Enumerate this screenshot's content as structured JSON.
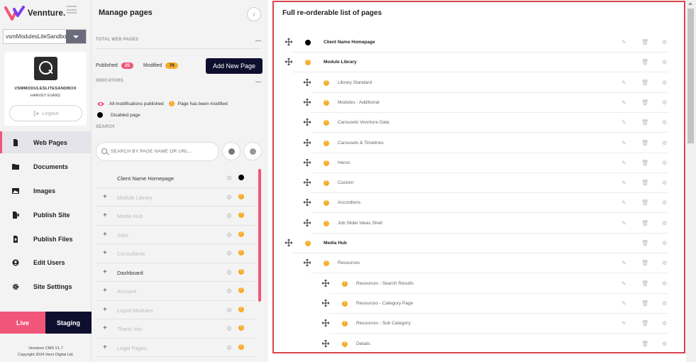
{
  "brand": {
    "name": "Vennture."
  },
  "site_select": {
    "value": "vsmModulesLiteSandbo"
  },
  "profile": {
    "site_name": "VSMMODULESLITESANDBOX",
    "user_name": "HARVEY EVANS",
    "logout_label": "Logout"
  },
  "nav": {
    "items": [
      {
        "label": "Web Pages",
        "icon": "file-icon",
        "active": true
      },
      {
        "label": "Documents",
        "icon": "folder-icon"
      },
      {
        "label": "Images",
        "icon": "image-icon"
      },
      {
        "label": "Publish Site",
        "icon": "publish-icon"
      },
      {
        "label": "Publish Files",
        "icon": "file-upload-icon"
      },
      {
        "label": "Edit Users",
        "icon": "user-icon"
      },
      {
        "label": "Site Settings",
        "icon": "gear-icon"
      }
    ]
  },
  "env": {
    "live_label": "Live",
    "staging_label": "Staging"
  },
  "footer": {
    "version": "Vennture CMS V1.7",
    "copyright": "Copyright 2024 Venn Digital Ltd."
  },
  "manage": {
    "title": "Manage pages",
    "total_label": "TOTAL WEB PAGES",
    "published_label": "Published",
    "published_count": "25",
    "modified_label": "Modified",
    "modified_count": "70",
    "add_button": "Add New Page",
    "indicators_label": "INDICATORS",
    "ind_all_published": "All modifications published",
    "ind_modified": "Page has been modified",
    "ind_disabled": "Disabled page",
    "search_label": "SEARCH",
    "search_placeholder": "SEARCH BY PAGE NAME OR URL...",
    "pages": [
      {
        "label": "Client Name Homepage",
        "status": "black",
        "expand": false,
        "muted": false
      },
      {
        "label": "Module Library",
        "status": "orange",
        "expand": true,
        "muted": true
      },
      {
        "label": "Media Hub",
        "status": "orange",
        "expand": true,
        "muted": true
      },
      {
        "label": "Jobs",
        "status": "orange",
        "expand": true,
        "muted": true
      },
      {
        "label": "Consultants",
        "status": "orange",
        "expand": true,
        "muted": true
      },
      {
        "label": "Dashboard",
        "status": "orange",
        "expand": true,
        "muted": false
      },
      {
        "label": "Account",
        "status": "orange",
        "expand": true,
        "muted": true
      },
      {
        "label": "Liquid Modules",
        "status": "orange",
        "expand": true,
        "muted": true
      },
      {
        "label": "Thank You",
        "status": "orange",
        "expand": true,
        "muted": true
      },
      {
        "label": "Legal Pages",
        "status": "orange",
        "expand": true,
        "muted": true
      }
    ]
  },
  "reorder": {
    "title": "Full re-orderable list of pages",
    "rows": [
      {
        "label": "Client Name Homepage",
        "level": 0,
        "status": "black",
        "bold": true,
        "edit": true
      },
      {
        "label": "Module Library",
        "level": 0,
        "status": "orange",
        "bold": true,
        "edit": false
      },
      {
        "label": "Library Standard",
        "level": 1,
        "status": "orange",
        "bold": false,
        "edit": true
      },
      {
        "label": "Modules - Additional",
        "level": 1,
        "status": "orange",
        "bold": false,
        "edit": true
      },
      {
        "label": "Carousels Vennture Data",
        "level": 1,
        "status": "orange",
        "bold": false,
        "edit": true
      },
      {
        "label": "Carousels & Timelines",
        "level": 1,
        "status": "orange",
        "bold": false,
        "edit": true
      },
      {
        "label": "Heros",
        "level": 1,
        "status": "orange",
        "bold": false,
        "edit": true
      },
      {
        "label": "Custom",
        "level": 1,
        "status": "orange",
        "bold": false,
        "edit": true
      },
      {
        "label": "Accordions",
        "level": 1,
        "status": "orange",
        "bold": false,
        "edit": true
      },
      {
        "label": "Job Slider Ideas Shell",
        "level": 1,
        "status": "orange",
        "bold": false,
        "edit": true
      },
      {
        "label": "Media Hub",
        "level": 0,
        "status": "orange",
        "bold": true,
        "edit": false
      },
      {
        "label": "Resources",
        "level": 1,
        "status": "orange",
        "bold": false,
        "edit": true
      },
      {
        "label": "Resources - Search Results",
        "level": 2,
        "status": "orange",
        "bold": false,
        "edit": true
      },
      {
        "label": "Resources - Category Page",
        "level": 2,
        "status": "orange",
        "bold": false,
        "edit": true
      },
      {
        "label": "Resources - Sub Category",
        "level": 2,
        "status": "orange",
        "bold": false,
        "edit": true
      },
      {
        "label": "Details",
        "level": 2,
        "status": "orange",
        "bold": false,
        "edit": false
      }
    ]
  },
  "colors": {
    "brand_pink": "#f2557a",
    "navy": "#0e0f2e",
    "modified_orange": "#f6ae2d",
    "highlight_red": "#d9434c"
  }
}
